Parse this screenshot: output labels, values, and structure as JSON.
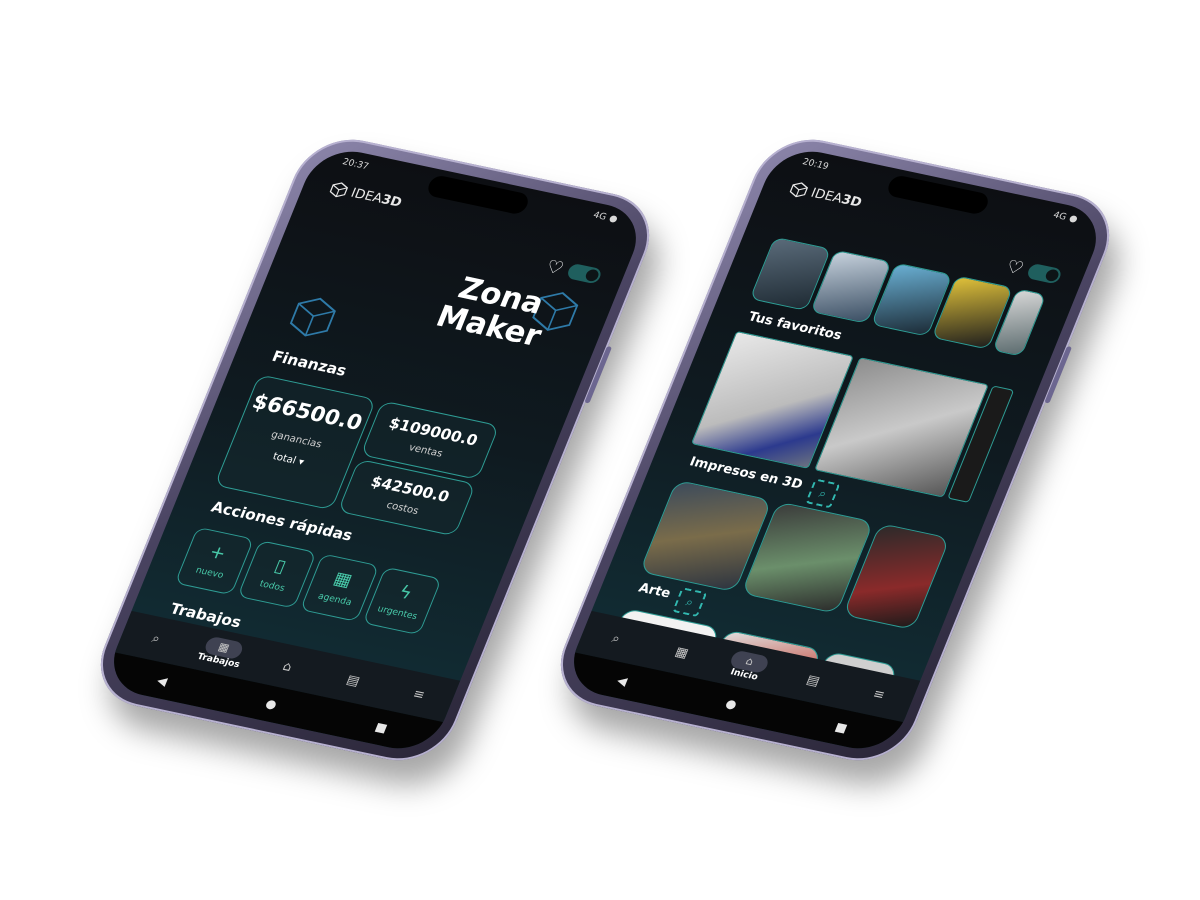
{
  "phone_left": {
    "status": {
      "time": "20:37",
      "indicators": "4G"
    },
    "logo": {
      "brand_left": "IDEA",
      "brand_right": "3D"
    },
    "title_line1": "Zona",
    "title_line2": "Maker",
    "finanzas_heading": "Finanzas",
    "ganancias": {
      "amount": "$66500.0",
      "label": "ganancias",
      "period": "total"
    },
    "ventas": {
      "amount": "$109000.0",
      "label": "ventas"
    },
    "costos": {
      "amount": "$42500.0",
      "label": "costos"
    },
    "acciones_heading": "Acciones rápidas",
    "quick_actions": [
      {
        "icon": "+",
        "label": "nuevo"
      },
      {
        "icon": "▯",
        "label": "todos"
      },
      {
        "icon": "▦",
        "label": "agenda"
      },
      {
        "icon": "ϟ",
        "label": "urgentes"
      }
    ],
    "trabajos_heading": "Trabajos",
    "nav": {
      "active_label": "Trabajos"
    }
  },
  "phone_right": {
    "status": {
      "time": "20:19",
      "indicators": "4G"
    },
    "logo": {
      "brand_left": "IDEA",
      "brand_right": "3D"
    },
    "favoritos_heading": "Tus favoritos",
    "impresos_heading": "Impresos en 3D",
    "arte_heading": "Arte",
    "nav": {
      "active_label": "Inicio"
    }
  },
  "colors": {
    "accent": "#2e9c94",
    "accent_light": "#48c9a9",
    "screen_bg": "#0d0f13"
  },
  "icons": {
    "search": "search-icon",
    "heart": "heart-icon",
    "theme": "theme-toggle",
    "home": "home-icon"
  }
}
